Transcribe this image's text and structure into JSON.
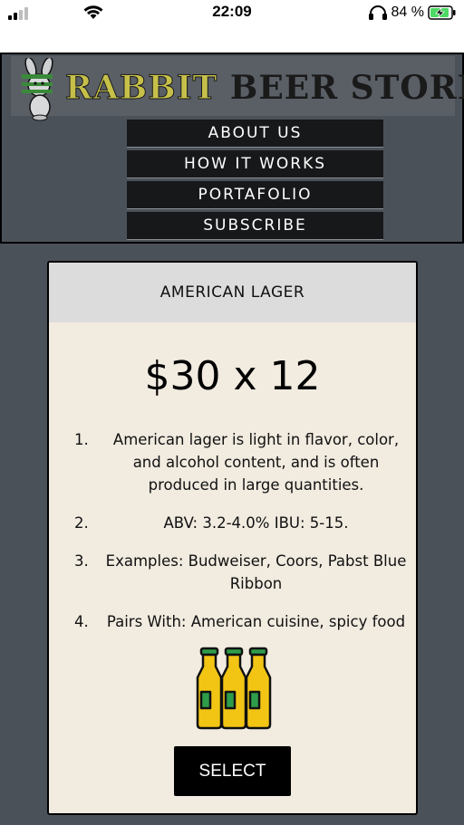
{
  "status_bar": {
    "time": "22:09",
    "battery_percent": "84 %"
  },
  "brand": {
    "word1": "RABBIT",
    "word2": "BEER STORE"
  },
  "nav": {
    "items": [
      "ABOUT US",
      "HOW IT WORKS",
      "PORTAFOLIO",
      "SUBSCRIBE"
    ]
  },
  "product": {
    "title": "AMERICAN LAGER",
    "price": "$30 x 12",
    "features": [
      {
        "num": "1.",
        "text": "American lager is light in flavor, color, and alcohol content, and is often produced in large quantities."
      },
      {
        "num": "2.",
        "text": "ABV: 3.2-4.0% IBU: 5-15."
      },
      {
        "num": "3.",
        "text": "Examples: Budweiser, Coors, Pabst Blue Ribbon"
      },
      {
        "num": "4.",
        "text": "Pairs With: American cuisine, spicy food"
      }
    ],
    "select_label": "SELECT"
  },
  "colors": {
    "background": "#4b5159",
    "card": "#f1ebe0",
    "card_header": "#dcdcdc",
    "nav_button": "#17181a",
    "brand_yellow": "#c6c04a",
    "battery_green": "#4cd964"
  },
  "icons": [
    "signal-icon",
    "wifi-icon",
    "headphones-icon",
    "battery-charging-icon",
    "rabbit-logo-icon",
    "beer-bottles-icon"
  ]
}
